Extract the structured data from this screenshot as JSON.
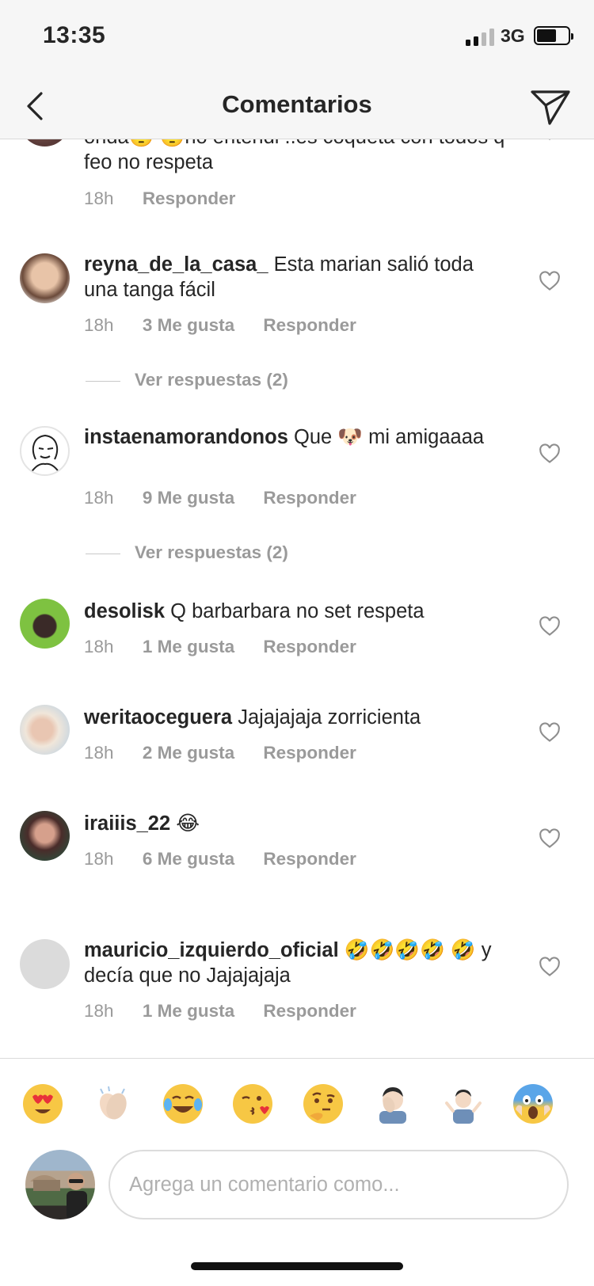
{
  "status_bar": {
    "time": "13:35",
    "network": "3G"
  },
  "header": {
    "title": "Comentarios"
  },
  "comments": [
    {
      "username": "",
      "text": "onda🙄 🙄no entendi ..es coqueta con todos q feo no respeta",
      "time": "18h",
      "likes": "",
      "reply": "Responder"
    },
    {
      "username": "reyna_de_la_casa_",
      "text": "Esta marian salió toda una tanga fácil",
      "time": "18h",
      "likes": "3 Me gusta",
      "reply": "Responder",
      "replies": "Ver respuestas (2)"
    },
    {
      "username": "instaenamorandonos",
      "text": "Que 🐶 mi amigaaaa",
      "time": "18h",
      "likes": "9 Me gusta",
      "reply": "Responder",
      "replies": "Ver respuestas (2)"
    },
    {
      "username": "desolisk",
      "text": "Q barbarbara no set respeta",
      "time": "18h",
      "likes": "1 Me gusta",
      "reply": "Responder"
    },
    {
      "username": "weritaoceguera",
      "text": "Jajajajaja zorricienta",
      "time": "18h",
      "likes": "2 Me gusta",
      "reply": "Responder"
    },
    {
      "username": "iraiiis_22",
      "text": "😂",
      "time": "18h",
      "likes": "6 Me gusta",
      "reply": "Responder"
    },
    {
      "username": "mauricio_izquierdo_oficial",
      "text": "🤣🤣🤣🤣 🤣 y decía que no Jajajajaja",
      "time": "18h",
      "likes": "1 Me gusta",
      "reply": "Responder"
    }
  ],
  "emoji_bar": [
    "😍",
    "👏🏻",
    "😂",
    "😘",
    "🤔",
    "🤦🏻‍♂️",
    "🤷🏻‍♂️",
    "😱"
  ],
  "composer": {
    "placeholder": "Agrega un comentario como..."
  },
  "icons": {
    "back": "chevron-left-icon",
    "send": "paper-plane-icon",
    "like": "heart-outline-icon"
  }
}
